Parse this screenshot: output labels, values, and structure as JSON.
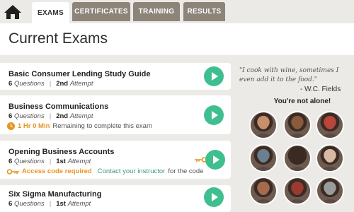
{
  "nav": {
    "tabs": [
      {
        "label": "EXAMS",
        "active": true
      },
      {
        "label": "CERTIFICATES",
        "active": false
      },
      {
        "label": "TRAINING",
        "active": false
      },
      {
        "label": "RESULTS",
        "active": false
      }
    ]
  },
  "page_title": "Current Exams",
  "exams": [
    {
      "title": "Basic Consumer Lending Study Guide",
      "questions_count": "6",
      "questions_label": "Questions",
      "attempt_num": "2nd",
      "attempt_label": "Attempt"
    },
    {
      "title": "Business Communications",
      "questions_count": "6",
      "questions_label": "Questions",
      "attempt_num": "2nd",
      "attempt_label": "Attempt",
      "timer_value": "1 Hr 0 Min",
      "timer_text": "Remaining to complete this exam"
    },
    {
      "title": "Opening Business Accounts",
      "questions_count": "6",
      "questions_label": "Questions",
      "attempt_num": "1st",
      "attempt_label": "Attempt",
      "access_text": "Access code required",
      "contact_link": "Contact your instructor",
      "contact_suffix": "for the code"
    },
    {
      "title": "Six Sigma Manufacturing",
      "questions_count": "6",
      "questions_label": "Questions",
      "attempt_num": "1st",
      "attempt_label": "Attempt"
    }
  ],
  "quote": {
    "text": "\"I cook with wine, sometimes I even add it to the food.\"",
    "author": "- W.C. Fields"
  },
  "community": {
    "heading": "You're not alone!",
    "avatar_colors": [
      "#c98e6b",
      "#8a5a3c",
      "#b8463a",
      "#6b7f8f",
      "#3b2a22",
      "#d8b9a3",
      "#a86a4c",
      "#9a3a30",
      "#9a9a9a"
    ]
  },
  "colors": {
    "accent": "#3fbf8f",
    "tab_inactive": "#8c8478",
    "warning": "#e8941f",
    "link": "#3a9a6f"
  }
}
